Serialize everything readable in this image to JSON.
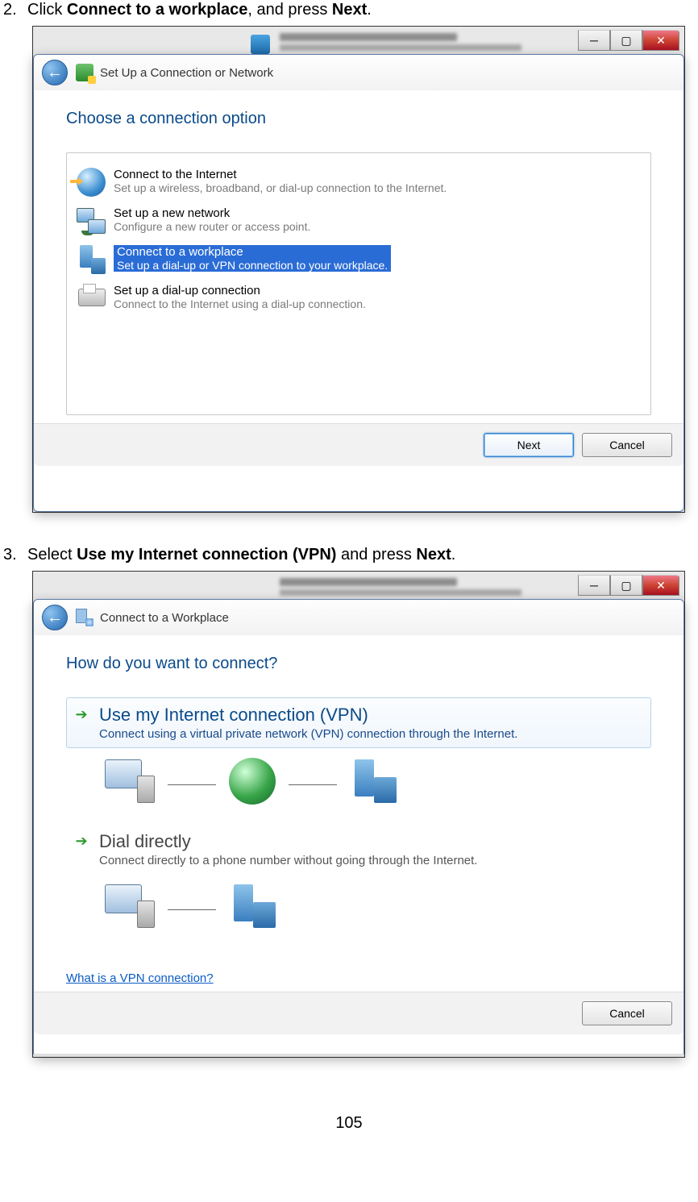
{
  "page_number": "105",
  "step2": {
    "num": "2.",
    "pre": "Click ",
    "bold1": "Connect to a workplace",
    "mid": ", and press ",
    "bold2": "Next",
    "post": "."
  },
  "step3": {
    "num": "3.",
    "pre": "Select ",
    "bold1": "Use my Internet connection (VPN)",
    "mid": " and press ",
    "bold2": "Next",
    "post": "."
  },
  "dlg1": {
    "title": "Set Up a Connection or Network",
    "heading": "Choose a connection option",
    "options": [
      {
        "title": "Connect to the Internet",
        "desc": "Set up a wireless, broadband, or dial-up connection to the Internet."
      },
      {
        "title": "Set up a new network",
        "desc": "Configure a new router or access point."
      },
      {
        "title": "Connect to a workplace",
        "desc": "Set up a dial-up or VPN connection to your workplace."
      },
      {
        "title": "Set up a dial-up connection",
        "desc": "Connect to the Internet using a dial-up connection."
      }
    ],
    "next": "Next",
    "cancel": "Cancel"
  },
  "dlg2": {
    "title": "Connect to a Workplace",
    "heading": "How do you want to connect?",
    "opt_vpn": {
      "title": "Use my Internet connection (VPN)",
      "desc": "Connect using a virtual private network (VPN) connection through the Internet."
    },
    "opt_dial": {
      "title": "Dial directly",
      "desc": "Connect directly to a phone number without going through the Internet."
    },
    "help": "What is a VPN connection?",
    "cancel": "Cancel"
  }
}
